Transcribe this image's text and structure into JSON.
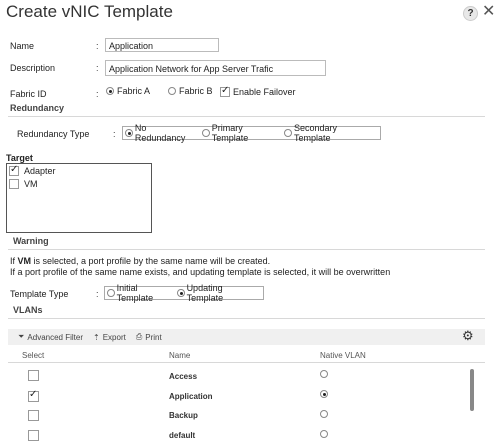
{
  "window": {
    "title": "Create vNIC Template",
    "help_label": "?",
    "close_label": "✕"
  },
  "form": {
    "name": {
      "label": "Name",
      "value": "Application"
    },
    "description": {
      "label": "Description",
      "value": "Application Network for App Server Trafic"
    },
    "fabric_id": {
      "label": "Fabric ID",
      "fabric_a": "Fabric A",
      "fabric_b": "Fabric B",
      "selected": "Fabric A",
      "enable_failover": "Enable Failover",
      "failover_checked": true
    }
  },
  "redundancy": {
    "section": "Redundancy",
    "type_label": "Redundancy Type",
    "options": [
      "No Redundancy",
      "Primary Template",
      "Secondary Template"
    ],
    "selected": "No Redundancy"
  },
  "target": {
    "section": "Target",
    "items": [
      {
        "label": "Adapter",
        "checked": true
      },
      {
        "label": "VM",
        "checked": false
      }
    ]
  },
  "warning": {
    "section": "Warning",
    "line1_pre": "If ",
    "line1_bold": "VM",
    "line1_post": " is selected, a port profile by the same name will be created.",
    "line2": "If a port profile of the same name exists, and updating template is selected, it will be overwritten"
  },
  "template_type": {
    "label": "Template Type",
    "options": [
      "Initial Template",
      "Updating Template"
    ],
    "selected": "Updating Template"
  },
  "vlans": {
    "section": "VLANs",
    "toolbar": {
      "filter": "Advanced Filter",
      "export": "Export",
      "print": "Print"
    },
    "columns": [
      "Select",
      "Name",
      "Native VLAN"
    ],
    "rows": [
      {
        "name": "Access",
        "selected": false,
        "native": false
      },
      {
        "name": "Application",
        "selected": true,
        "native": true
      },
      {
        "name": "Backup",
        "selected": false,
        "native": false
      },
      {
        "name": "default",
        "selected": false,
        "native": false
      }
    ]
  }
}
